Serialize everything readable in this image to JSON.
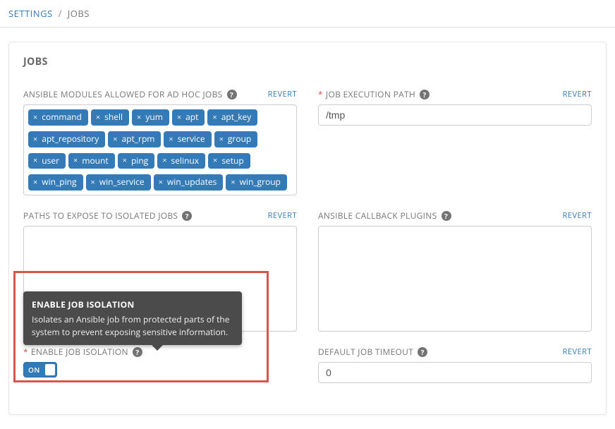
{
  "breadcrumb": {
    "parent_label": "SETTINGS",
    "current_label": "JOBS"
  },
  "page": {
    "title": "JOBS",
    "revert_label": "REVERT"
  },
  "fields": {
    "modules": {
      "label": "ANSIBLE MODULES ALLOWED FOR AD HOC JOBS",
      "tags": [
        "command",
        "shell",
        "yum",
        "apt",
        "apt_key",
        "apt_repository",
        "apt_rpm",
        "service",
        "group",
        "user",
        "mount",
        "ping",
        "selinux",
        "setup",
        "win_ping",
        "win_service",
        "win_updates",
        "win_group"
      ]
    },
    "exec_path": {
      "label": "JOB EXECUTION PATH",
      "value": "/tmp",
      "required": true
    },
    "paths_expose": {
      "label": "PATHS TO EXPOSE TO ISOLATED JOBS",
      "value": ""
    },
    "callback": {
      "label": "ANSIBLE CALLBACK PLUGINS",
      "value": ""
    },
    "isolation": {
      "label": "ENABLE JOB ISOLATION",
      "required": true,
      "toggle_label": "ON",
      "tooltip_title": "ENABLE JOB ISOLATION",
      "tooltip_body": "Isolates an Ansible job from protected parts of the system to prevent exposing sensitive information."
    },
    "timeout": {
      "label": "DEFAULT JOB TIMEOUT",
      "value": "0"
    }
  }
}
